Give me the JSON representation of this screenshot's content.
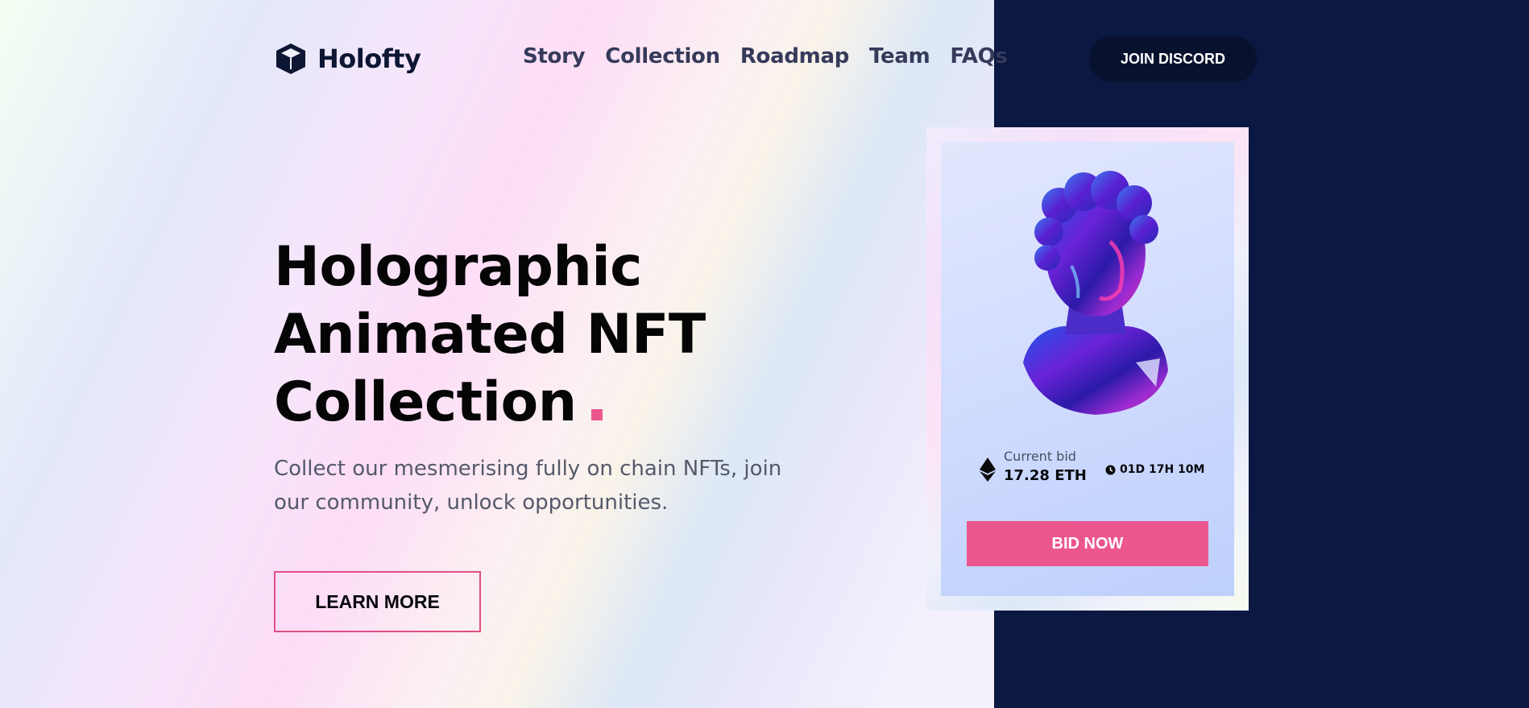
{
  "brand": {
    "name": "Holofty",
    "logo_icon": "cube-icon"
  },
  "nav": {
    "items": [
      "Story",
      "Collection",
      "Roadmap",
      "Team",
      "FAQs"
    ]
  },
  "header": {
    "cta_label": "JOIN DISCORD"
  },
  "hero": {
    "title_lines": [
      "Holographic",
      "Animated NFT",
      "Collection"
    ],
    "accent_mark": "square-dot",
    "subtitle": "Collect our mesmerising fully on chain NFTs, join our community, unlock opportunities.",
    "cta_label": "LEARN MORE"
  },
  "nft_card": {
    "image": "holographic-bust-image",
    "bid_label": "Current bid",
    "bid_value": "17.28 ETH",
    "bid_icon": "ethereum-icon",
    "timer_icon": "clock-icon",
    "timer_text": "01D 17H 10M",
    "cta_label": "BID NOW"
  },
  "colors": {
    "accent_pink": "#ec568e",
    "navy": "#0b1841",
    "button_dark": "#08122e",
    "text_dark": "#0d1633"
  }
}
